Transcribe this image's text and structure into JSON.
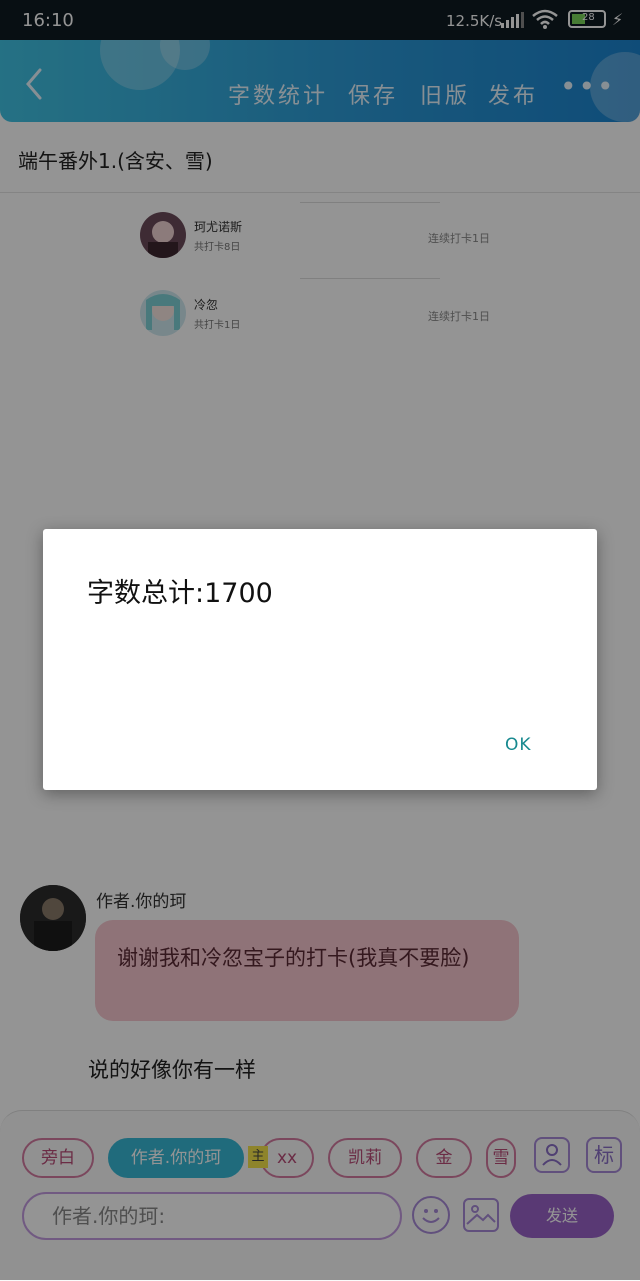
{
  "status_bar": {
    "time": "16:10",
    "network_speed": "12.5K/s",
    "battery_level": "28",
    "battery_fraction": 0.28,
    "icons": [
      "signal-icon",
      "wifi-icon",
      "battery-icon",
      "charging-icon"
    ]
  },
  "header": {
    "back_icon": "chevron-left-icon",
    "actions": [
      "字数统计",
      "保存",
      "旧版",
      "发布"
    ],
    "more_icon": "more-dots-icon",
    "gradient": [
      "#41c3e3",
      "#1b84cf"
    ]
  },
  "document": {
    "title": "端午番外1.(含安、雪)"
  },
  "checkins": [
    {
      "name": "珂尤诺斯",
      "days": "共打卡8日",
      "status": "连续打卡1日"
    },
    {
      "name": "冷忽",
      "days": "共打卡1日",
      "status": "连续打卡1日"
    }
  ],
  "chat": {
    "author_label": "作者.你的珂",
    "message": "谢谢我和冷忽宝子的打卡(我真不要脸)",
    "reply": "说的好像你有一样",
    "bubble_color": "#f7c6cf"
  },
  "input_panel": {
    "chips": [
      "旁白",
      "作者.你的珂",
      "xx",
      "凯莉",
      "金",
      "雪"
    ],
    "active_chip": "作者.你的珂",
    "chip_tag": "主",
    "profile_icon": "person-card-icon",
    "tag_button_label": "标",
    "input_value": "作者.你的珂:",
    "emoji_icon": "emoji-icon",
    "image_icon": "image-icon",
    "send_label": "发送",
    "accent_color": "#9a62c9"
  },
  "dialog": {
    "message": "字数总计:1700",
    "ok_label": "OK",
    "ok_color": "#17898f"
  }
}
